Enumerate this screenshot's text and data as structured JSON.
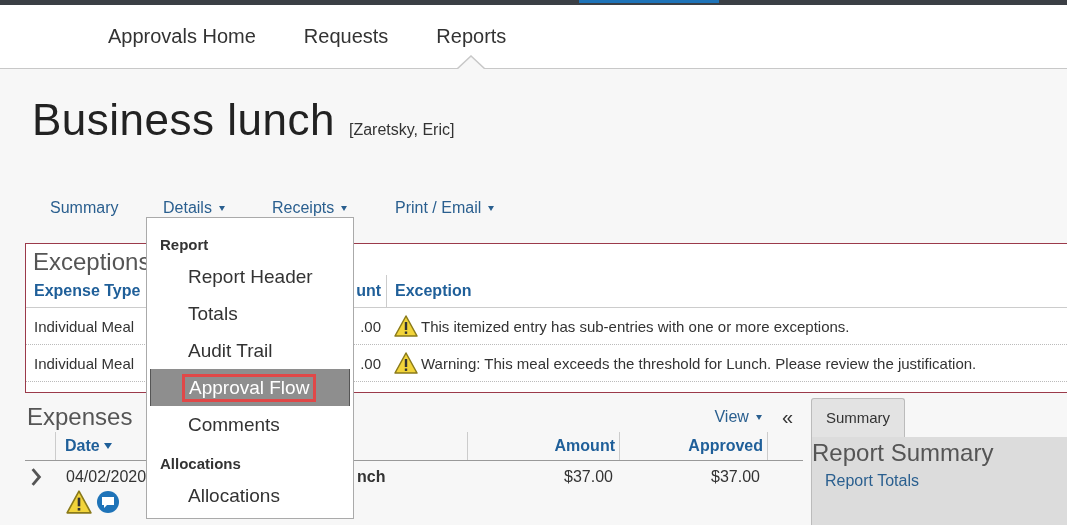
{
  "top_nav": [
    {
      "label": "Approvals Home",
      "selected": false
    },
    {
      "label": "Requests",
      "selected": false
    },
    {
      "label": "Reports",
      "selected": true
    }
  ],
  "report": {
    "title": "Business lunch",
    "owner": "[Zaretsky, Eric]"
  },
  "report_menu": [
    {
      "label": "Summary",
      "has_dropdown": false
    },
    {
      "label": "Details",
      "has_dropdown": true
    },
    {
      "label": "Receipts",
      "has_dropdown": true
    },
    {
      "label": "Print / Email",
      "has_dropdown": true
    }
  ],
  "dropdown": {
    "sections": [
      {
        "heading": "Report",
        "items": [
          {
            "label": "Report Header",
            "selected": false
          },
          {
            "label": "Totals",
            "selected": false
          },
          {
            "label": "Audit Trail",
            "selected": false
          },
          {
            "label": "Approval Flow",
            "selected": true
          },
          {
            "label": "Comments",
            "selected": false
          }
        ]
      },
      {
        "heading": "Allocations",
        "items": [
          {
            "label": "Allocations",
            "selected": false
          }
        ]
      }
    ]
  },
  "exceptions": {
    "title": "Exceptions",
    "columns": [
      "Expense Type",
      "unt",
      "Exception"
    ],
    "rows": [
      {
        "expense_type": "Individual Meal",
        "amount": ".00",
        "exception": "This itemized entry has sub-entries with one or more exceptions."
      },
      {
        "expense_type": "Individual Meal",
        "amount": ".00",
        "exception": "Warning: This meal exceeds the threshold for Lunch. Please review the justification."
      }
    ]
  },
  "expenses": {
    "title": "Expenses",
    "view": "View",
    "collapse": "«",
    "columns": [
      "Date",
      "Amount",
      "Approved"
    ],
    "rows": [
      {
        "date": "04/02/2020",
        "description": "nch",
        "amount": "$37.00",
        "approved": "$37.00",
        "warning": true,
        "comment": true
      }
    ]
  },
  "summary_panel": {
    "tab": "Summary",
    "title": "Report Summary",
    "link": "Report Totals"
  }
}
